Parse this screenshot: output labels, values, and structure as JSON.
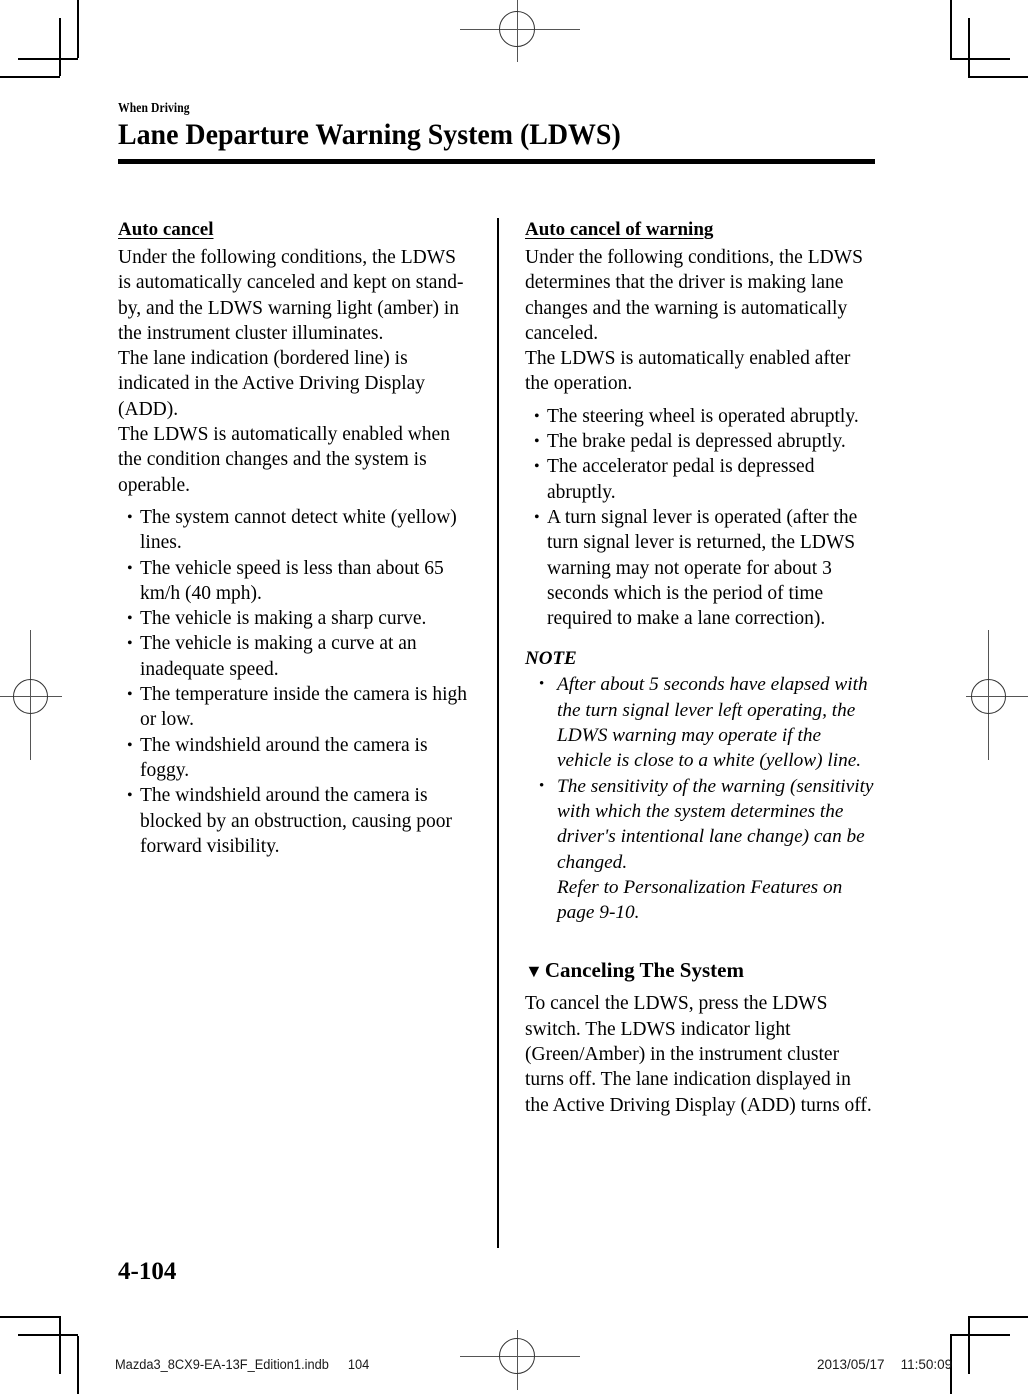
{
  "header": {
    "chapter_label": "When Driving",
    "title": "Lane Departure Warning System (LDWS)"
  },
  "left_column": {
    "sub_head": "Auto cancel",
    "intro": "Under the following conditions, the LDWS is automatically canceled and kept on stand-by, and the LDWS warning light (amber) in the instrument cluster illuminates.\nThe lane indication (bordered line) is indicated in the Active Driving Display (ADD).\nThe LDWS is automatically enabled when the condition changes and the system is operable.",
    "bullets": [
      "The system cannot detect white (yellow) lines.",
      "The vehicle speed is less than about 65 km/h (40 mph).",
      "The vehicle is making a sharp curve.",
      "The vehicle is making a curve at an inadequate speed.",
      "The temperature inside the camera is high or low.",
      "The windshield around the camera is foggy.",
      "The windshield around the camera is blocked by an obstruction, causing poor forward visibility."
    ]
  },
  "right_column": {
    "sub_head": "Auto cancel of warning",
    "intro": "Under the following conditions, the LDWS determines that the driver is making lane changes and the warning is automatically canceled.\nThe LDWS is automatically enabled after the operation.",
    "bullets": [
      "The steering wheel is operated abruptly.",
      "The brake pedal is depressed abruptly.",
      "The accelerator pedal is depressed abruptly.",
      "A turn signal lever is operated (after the turn signal lever is returned, the LDWS warning may not operate for about 3 seconds which is the period of time required to make a lane correction)."
    ],
    "note": {
      "label": "NOTE",
      "items": [
        "After about 5 seconds have elapsed with the turn signal lever left operating, the LDWS warning may operate if the vehicle is close to a white (yellow) line.",
        "The sensitivity of the warning (sensitivity with which the system determines the driver's intentional lane change) can be changed.",
        "Refer to Personalization Features on page 9-10."
      ]
    },
    "section": {
      "triangle": "▼",
      "heading": "Canceling The System",
      "body": "To cancel the LDWS, press the LDWS switch. The LDWS indicator light (Green/Amber) in the instrument cluster turns off. The lane indication displayed in the Active Driving Display (ADD) turns off."
    }
  },
  "page_number": "4-104",
  "footer": {
    "file_name": "Mazda3_8CX9-EA-13F_Edition1.indb",
    "sheet_number": "104",
    "date": "2013/05/17",
    "time": "11:50:09"
  }
}
